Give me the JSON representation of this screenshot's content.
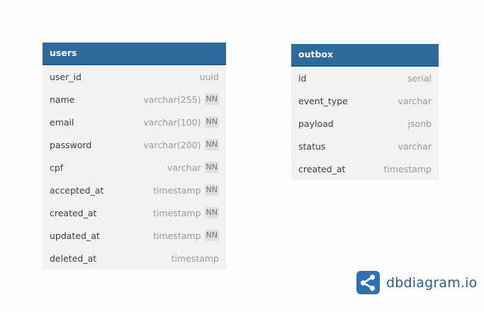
{
  "tables": [
    {
      "name": "users",
      "columns": [
        {
          "name": "user_id",
          "type": "uuid",
          "nn": ""
        },
        {
          "name": "name",
          "type": "varchar(255)",
          "nn": "NN"
        },
        {
          "name": "email",
          "type": "varchar(100)",
          "nn": "NN"
        },
        {
          "name": "password",
          "type": "varchar(200)",
          "nn": "NN"
        },
        {
          "name": "cpf",
          "type": "varchar",
          "nn": "NN"
        },
        {
          "name": "accepted_at",
          "type": "timestamp",
          "nn": "NN"
        },
        {
          "name": "created_at",
          "type": "timestamp",
          "nn": "NN"
        },
        {
          "name": "updated_at",
          "type": "timestamp",
          "nn": "NN"
        },
        {
          "name": "deleted_at",
          "type": "timestamp",
          "nn": ""
        }
      ]
    },
    {
      "name": "outbox",
      "columns": [
        {
          "name": "id",
          "type": "serial",
          "nn": ""
        },
        {
          "name": "event_type",
          "type": "varchar",
          "nn": ""
        },
        {
          "name": "payload",
          "type": "jsonb",
          "nn": ""
        },
        {
          "name": "status",
          "type": "varchar",
          "nn": ""
        },
        {
          "name": "created_at",
          "type": "timestamp",
          "nn": ""
        }
      ]
    }
  ],
  "brand": {
    "text": "dbdiagram.io",
    "icon": "share-nodes-icon",
    "color": "#2b5a8c"
  },
  "colors": {
    "header": "#2f6a9c",
    "row_bg": "#f2f2f2"
  }
}
